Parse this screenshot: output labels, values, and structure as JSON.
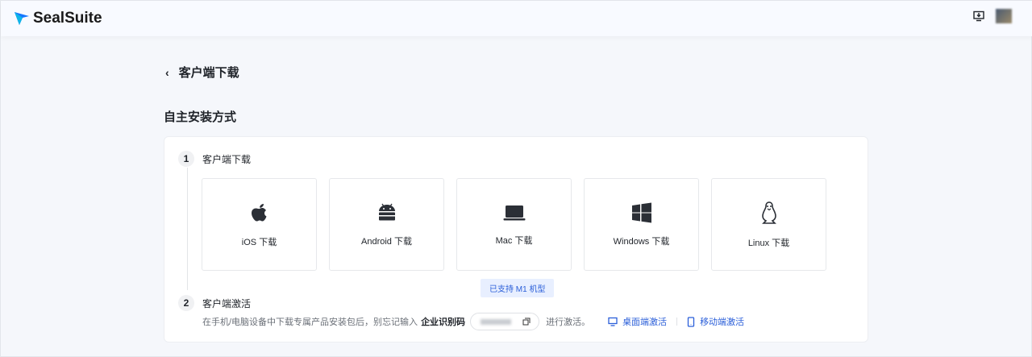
{
  "header": {
    "brand": "SealSuite",
    "colors": {
      "accent": "#2b5fd9"
    }
  },
  "page": {
    "back_title": "客户端下载",
    "section_title": "自主安装方式"
  },
  "steps": [
    {
      "number": "1",
      "label": "客户端下载"
    },
    {
      "number": "2",
      "label": "客户端激活"
    }
  ],
  "downloads": [
    {
      "icon": "apple-icon",
      "label": "iOS 下载"
    },
    {
      "icon": "android-icon",
      "label": "Android 下载"
    },
    {
      "icon": "laptop-icon",
      "label": "Mac 下载"
    },
    {
      "icon": "windows-icon",
      "label": "Windows 下载"
    },
    {
      "icon": "linux-icon",
      "label": "Linux 下载"
    }
  ],
  "mac_badge": "已支持 M1 机型",
  "activation": {
    "text_before": "在手机/电脑设备中下载专属产品安装包后，别忘记输入",
    "code_label": "企业识别码",
    "text_after": "进行激活。",
    "desktop_link": "桌面端激活",
    "mobile_link": "移动端激活"
  }
}
